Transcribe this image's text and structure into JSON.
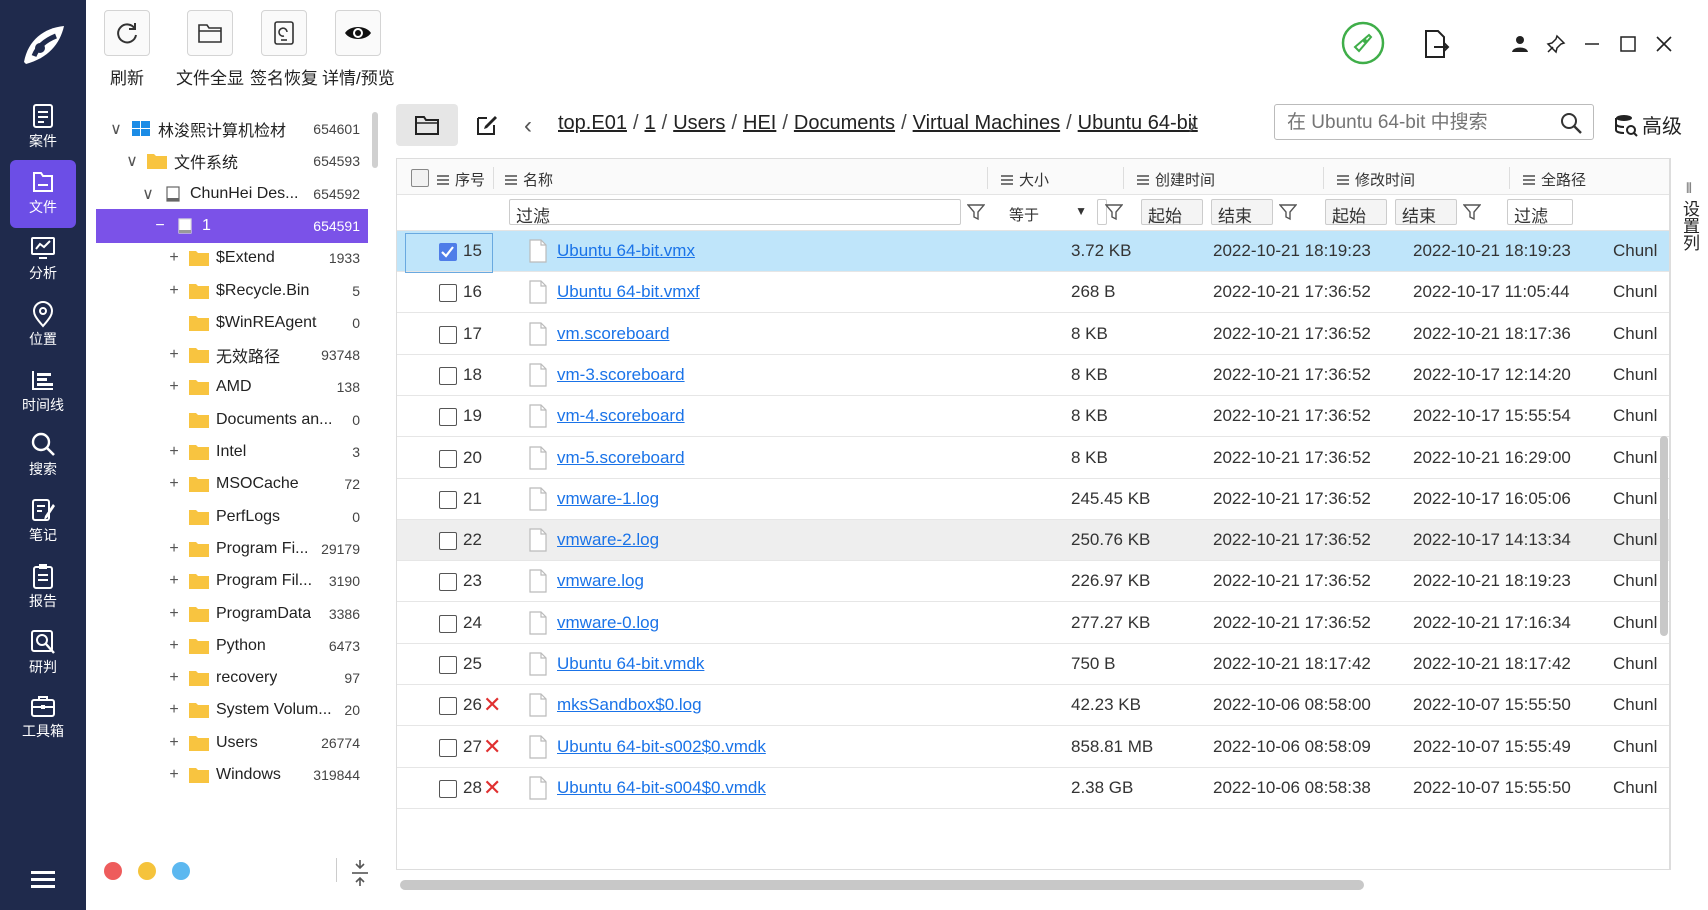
{
  "nav": {
    "items": [
      {
        "label": "案件",
        "icon": "case-icon"
      },
      {
        "label": "文件",
        "icon": "file-icon",
        "active": true
      },
      {
        "label": "分析",
        "icon": "analysis-icon"
      },
      {
        "label": "位置",
        "icon": "location-icon"
      },
      {
        "label": "时间线",
        "icon": "timeline-icon"
      },
      {
        "label": "搜索",
        "icon": "search-icon"
      },
      {
        "label": "笔记",
        "icon": "note-icon"
      },
      {
        "label": "报告",
        "icon": "report-icon"
      },
      {
        "label": "研判",
        "icon": "investigate-icon"
      },
      {
        "label": "工具箱",
        "icon": "toolbox-icon"
      }
    ]
  },
  "toolbar": {
    "refresh": "刷新",
    "show_all": "文件全显",
    "signature_recovery": "签名恢复",
    "detail_preview": "详情/预览"
  },
  "tree": {
    "items": [
      {
        "toggle": "∨",
        "name": "林浚熙计算机检材",
        "count": "654601",
        "icon": "windows-icon"
      },
      {
        "toggle": "∨",
        "name": "文件系统",
        "count": "654593",
        "icon": "folder-icon"
      },
      {
        "toggle": "∨",
        "name": "ChunHei Des...",
        "count": "654592",
        "icon": "disk-icon"
      },
      {
        "toggle": "−",
        "name": "1",
        "count": "654591",
        "icon": "partition-icon",
        "selected": true
      },
      {
        "toggle": "+",
        "name": "$Extend",
        "count": "1933",
        "icon": "folder-icon"
      },
      {
        "toggle": "+",
        "name": "$Recycle.Bin",
        "count": "5",
        "icon": "folder-icon"
      },
      {
        "toggle": "",
        "name": "$WinREAgent",
        "count": "0",
        "icon": "folder-icon"
      },
      {
        "toggle": "+",
        "name": "无效路径",
        "count": "93748",
        "icon": "folder-icon"
      },
      {
        "toggle": "+",
        "name": "AMD",
        "count": "138",
        "icon": "folder-icon"
      },
      {
        "toggle": "",
        "name": "Documents an...",
        "count": "0",
        "icon": "folder-icon"
      },
      {
        "toggle": "+",
        "name": "Intel",
        "count": "3",
        "icon": "folder-icon"
      },
      {
        "toggle": "+",
        "name": "MSOCache",
        "count": "72",
        "icon": "folder-icon"
      },
      {
        "toggle": "",
        "name": "PerfLogs",
        "count": "0",
        "icon": "folder-icon"
      },
      {
        "toggle": "+",
        "name": "Program Fi...",
        "count": "29179",
        "icon": "folder-icon"
      },
      {
        "toggle": "+",
        "name": "Program Fil...",
        "count": "3190",
        "icon": "folder-icon"
      },
      {
        "toggle": "+",
        "name": "ProgramData",
        "count": "3386",
        "icon": "folder-icon"
      },
      {
        "toggle": "+",
        "name": "Python",
        "count": "6473",
        "icon": "folder-icon"
      },
      {
        "toggle": "+",
        "name": "recovery",
        "count": "97",
        "icon": "folder-icon"
      },
      {
        "toggle": "+",
        "name": "System Volum...",
        "count": "20",
        "icon": "folder-icon"
      },
      {
        "toggle": "+",
        "name": "Users",
        "count": "26774",
        "icon": "folder-icon"
      },
      {
        "toggle": "+",
        "name": "Windows",
        "count": "319844",
        "icon": "folder-icon"
      }
    ],
    "dot_colors": [
      "#ee5c5c",
      "#f5c33b",
      "#5cb8f0"
    ]
  },
  "path": {
    "crumbs": [
      "top.E01",
      "1",
      "Users",
      "HEI",
      "Documents",
      "Virtual Machines",
      "Ubuntu 64-bit"
    ],
    "separator": "/",
    "search_placeholder": "在 Ubuntu 64-bit 中搜索",
    "advanced": "高级"
  },
  "grid": {
    "headers": {
      "no": "序号",
      "name": "名称",
      "size": "大小",
      "created": "创建时间",
      "modified": "修改时间",
      "fullpath": "全路径"
    },
    "filters": {
      "name": "过滤",
      "size_op": "等于",
      "start": "起始",
      "end": "结束",
      "path": "过滤"
    },
    "settings_label": "设置列",
    "rows": [
      {
        "no": "15",
        "name": "Ubuntu 64-bit.vmx",
        "size": "3.72 KB",
        "created": "2022-10-21 18:19:23",
        "modified": "2022-10-21 18:19:23",
        "path": "Chunl",
        "checked": true,
        "deleted": false
      },
      {
        "no": "16",
        "name": "Ubuntu 64-bit.vmxf",
        "size": "268 B",
        "created": "2022-10-21 17:36:52",
        "modified": "2022-10-17 11:05:44",
        "path": "Chunl",
        "checked": false,
        "deleted": false
      },
      {
        "no": "17",
        "name": "vm.scoreboard",
        "size": "8 KB",
        "created": "2022-10-21 17:36:52",
        "modified": "2022-10-21 18:17:36",
        "path": "Chunl",
        "checked": false,
        "deleted": false
      },
      {
        "no": "18",
        "name": "vm-3.scoreboard",
        "size": "8 KB",
        "created": "2022-10-21 17:36:52",
        "modified": "2022-10-17 12:14:20",
        "path": "Chunl",
        "checked": false,
        "deleted": false
      },
      {
        "no": "19",
        "name": "vm-4.scoreboard",
        "size": "8 KB",
        "created": "2022-10-21 17:36:52",
        "modified": "2022-10-17 15:55:54",
        "path": "Chunl",
        "checked": false,
        "deleted": false
      },
      {
        "no": "20",
        "name": "vm-5.scoreboard",
        "size": "8 KB",
        "created": "2022-10-21 17:36:52",
        "modified": "2022-10-21 16:29:00",
        "path": "Chunl",
        "checked": false,
        "deleted": false
      },
      {
        "no": "21",
        "name": "vmware-1.log",
        "size": "245.45 KB",
        "created": "2022-10-21 17:36:52",
        "modified": "2022-10-17 16:05:06",
        "path": "Chunl",
        "checked": false,
        "deleted": false
      },
      {
        "no": "22",
        "name": "vmware-2.log",
        "size": "250.76 KB",
        "created": "2022-10-21 17:36:52",
        "modified": "2022-10-17 14:13:34",
        "path": "Chunl",
        "checked": false,
        "deleted": false,
        "hover": true
      },
      {
        "no": "23",
        "name": "vmware.log",
        "size": "226.97 KB",
        "created": "2022-10-21 17:36:52",
        "modified": "2022-10-21 18:19:23",
        "path": "Chunl",
        "checked": false,
        "deleted": false
      },
      {
        "no": "24",
        "name": "vmware-0.log",
        "size": "277.27 KB",
        "created": "2022-10-21 17:36:52",
        "modified": "2022-10-21 17:16:34",
        "path": "Chunl",
        "checked": false,
        "deleted": false
      },
      {
        "no": "25",
        "name": "Ubuntu 64-bit.vmdk",
        "size": "750 B",
        "created": "2022-10-21 18:17:42",
        "modified": "2022-10-21 18:17:42",
        "path": "Chunl",
        "checked": false,
        "deleted": false
      },
      {
        "no": "26",
        "name": "mksSandbox$0.log",
        "size": "42.23 KB",
        "created": "2022-10-06 08:58:00",
        "modified": "2022-10-07 15:55:50",
        "path": "Chunl",
        "checked": false,
        "deleted": true
      },
      {
        "no": "27",
        "name": "Ubuntu 64-bit-s002$0.vmdk",
        "size": "858.81 MB",
        "created": "2022-10-06 08:58:09",
        "modified": "2022-10-07 15:55:49",
        "path": "Chunl",
        "checked": false,
        "deleted": true
      },
      {
        "no": "28",
        "name": "Ubuntu 64-bit-s004$0.vmdk",
        "size": "2.38 GB",
        "created": "2022-10-06 08:58:38",
        "modified": "2022-10-07 15:55:50",
        "path": "Chunl",
        "checked": false,
        "deleted": true
      }
    ]
  },
  "colors": {
    "nav_bg": "#1f2a4c",
    "nav_active": "#6c4ee6",
    "tree_selected": "#7b52e8",
    "row_selected": "#bfe5fa",
    "link": "#1a73e8",
    "deleted_mark": "#e03030",
    "folder": "#f8c440"
  }
}
